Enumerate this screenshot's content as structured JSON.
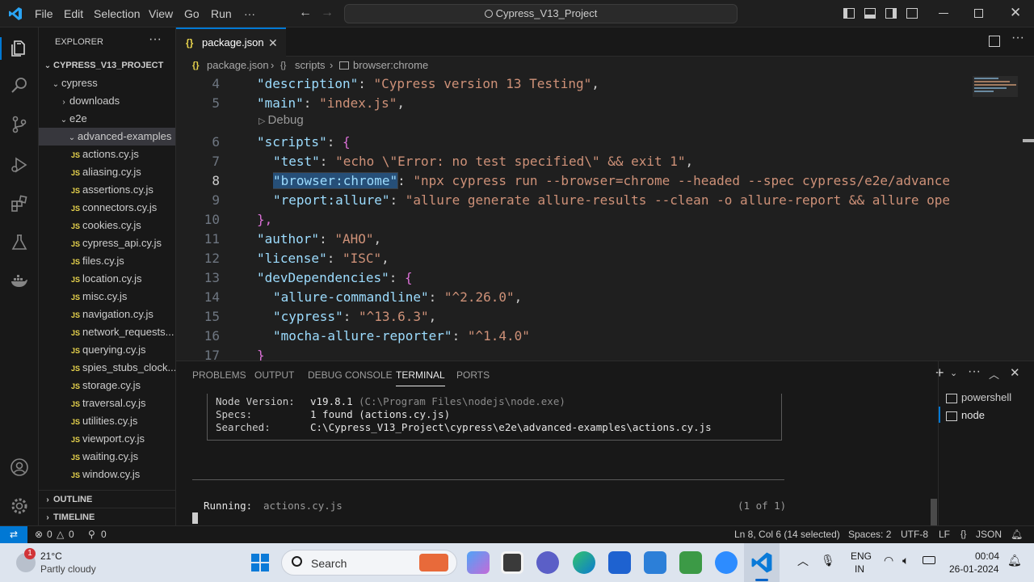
{
  "titlebar": {
    "menus": [
      "File",
      "Edit",
      "Selection",
      "View",
      "Go",
      "Run",
      "···"
    ],
    "search_text": "Cypress_V13_Project"
  },
  "sidebar": {
    "title": "EXPLORER",
    "project": "CYPRESS_V13_PROJECT",
    "folders": {
      "cypress": "cypress",
      "downloads": "downloads",
      "e2e": "e2e",
      "advanced": "advanced-examples"
    },
    "files": [
      "actions.cy.js",
      "aliasing.cy.js",
      "assertions.cy.js",
      "connectors.cy.js",
      "cookies.cy.js",
      "cypress_api.cy.js",
      "files.cy.js",
      "location.cy.js",
      "misc.cy.js",
      "navigation.cy.js",
      "network_requests...",
      "querying.cy.js",
      "spies_stubs_clock...",
      "storage.cy.js",
      "traversal.cy.js",
      "utilities.cy.js",
      "viewport.cy.js",
      "waiting.cy.js",
      "window.cy.js"
    ],
    "outline": "OUTLINE",
    "timeline": "TIMELINE",
    "js_badge": "JS"
  },
  "editor": {
    "tab_label": "package.json",
    "breadcrumb": [
      "package.json",
      "scripts",
      "browser:chrome"
    ],
    "codelens": "Debug",
    "lines": [
      {
        "n": "4",
        "key": "\"description\"",
        "sep": ": ",
        "val": "\"Cypress version 13 Testing\"",
        "end": ","
      },
      {
        "n": "5",
        "key": "\"main\"",
        "sep": ": ",
        "val": "\"index.js\"",
        "end": ","
      },
      {
        "n": "6",
        "key": "\"scripts\"",
        "sep": ": ",
        "val": "",
        "end": "{"
      },
      {
        "n": "7",
        "key": "\"test\"",
        "sep": ": ",
        "val": "\"echo \\\"Error: no test specified\\\" && exit 1\"",
        "end": ","
      },
      {
        "n": "8",
        "key": "\"browser:chrome\"",
        "sep": ": ",
        "val": "\"npx cypress run --browser=chrome --headed --spec cypress/e2e/advance",
        "end": ""
      },
      {
        "n": "9",
        "key": "\"report:allure\"",
        "sep": ": ",
        "val": "\"allure generate allure-results --clean -o allure-report && allure ope",
        "end": ""
      },
      {
        "n": "10",
        "key": "",
        "sep": "",
        "val": "",
        "end": "},"
      },
      {
        "n": "11",
        "key": "\"author\"",
        "sep": ": ",
        "val": "\"AHO\"",
        "end": ","
      },
      {
        "n": "12",
        "key": "\"license\"",
        "sep": ": ",
        "val": "\"ISC\"",
        "end": ","
      },
      {
        "n": "13",
        "key": "\"devDependencies\"",
        "sep": ": ",
        "val": "",
        "end": "{"
      },
      {
        "n": "14",
        "key": "\"allure-commandline\"",
        "sep": ": ",
        "val": "\"^2.26.0\"",
        "end": ","
      },
      {
        "n": "15",
        "key": "\"cypress\"",
        "sep": ": ",
        "val": "\"^13.6.3\"",
        "end": ","
      },
      {
        "n": "16",
        "key": "\"mocha-allure-reporter\"",
        "sep": ": ",
        "val": "\"^1.4.0\"",
        "end": ""
      },
      {
        "n": "17",
        "key": "",
        "sep": "",
        "val": "",
        "end": "}"
      }
    ]
  },
  "panel": {
    "tabs": [
      "PROBLEMS",
      "OUTPUT",
      "DEBUG CONSOLE",
      "TERMINAL",
      "PORTS"
    ],
    "terminals": [
      "powershell",
      "node"
    ],
    "info": [
      {
        "label": "Node Version:",
        "value": "v19.8.1",
        "extra": "(C:\\Program Files\\nodejs\\node.exe)"
      },
      {
        "label": "Specs:",
        "value": "1 found (actions.cy.js)",
        "extra": ""
      },
      {
        "label": "Searched:",
        "value": "C:\\Cypress_V13_Project\\cypress\\e2e\\advanced-examples\\actions.cy.js",
        "extra": ""
      }
    ],
    "running_label": "Running:",
    "running_file": "actions.cy.js",
    "running_count": "(1 of 1)"
  },
  "statusbar": {
    "errors": "0",
    "warnings": "0",
    "ports": "0",
    "position": "Ln 8, Col 6 (14 selected)",
    "spaces": "Spaces: 2",
    "encoding": "UTF-8",
    "eol": "LF",
    "language": "JSON"
  },
  "taskbar": {
    "temp": "21°C",
    "weather": "Partly cloudy",
    "weather_badge": "1",
    "search": "Search",
    "lang": "ENG",
    "region": "IN",
    "time": "00:04",
    "date": "26-01-2024"
  },
  "colors": {
    "accent": "#0078d4",
    "json_key": "#9cdcfe",
    "json_string": "#ce9178",
    "js_badge": "#e8d44d"
  }
}
